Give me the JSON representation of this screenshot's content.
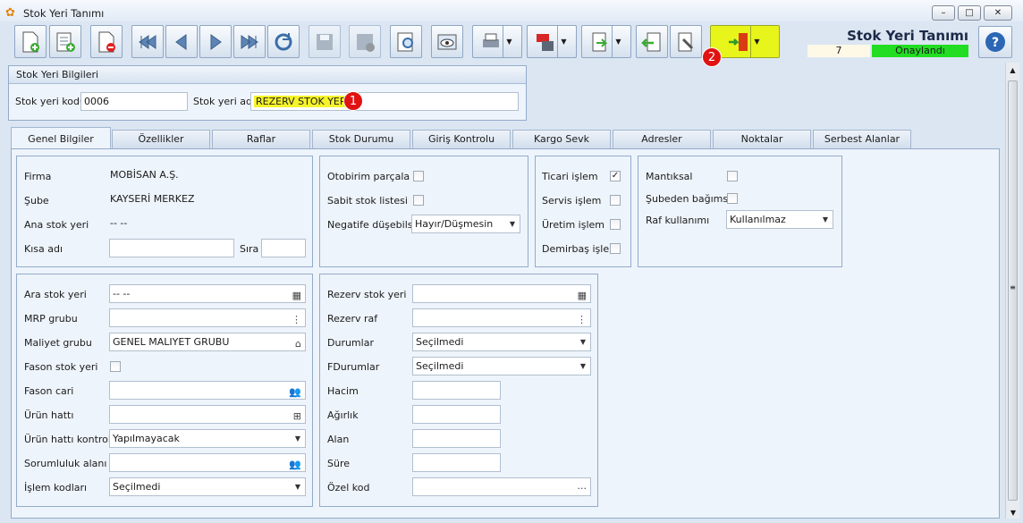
{
  "window": {
    "title": "Stok Yeri Tanımı"
  },
  "header": {
    "title": "Stok Yeri Tanımı",
    "record_no": "7",
    "status": "Onaylandı",
    "status_color": "#22dd22"
  },
  "group": {
    "title": "Stok Yeri Bilgileri",
    "code_label": "Stok yeri kodu",
    "code_value": "0006",
    "name_label": "Stok yeri adı",
    "name_value": "REZERV STOK YERİ"
  },
  "badges": [
    "1",
    "2"
  ],
  "tabs": [
    "Genel Bilgiler",
    "Özellikler",
    "Raflar",
    "Stok Durumu",
    "Giriş Kontrolu",
    "Kargo Sevk",
    "Adresler",
    "Noktalar",
    "Serbest Alanlar"
  ],
  "p1": {
    "firma_label": "Firma",
    "firma_value": "MOBİSAN A.Ş.",
    "sube_label": "Şube",
    "sube_value": "KAYSERİ MERKEZ",
    "ana_label": "Ana stok yeri",
    "ana_value": "-- --",
    "kisa_label": "Kısa adı",
    "sira_label": "Sıra"
  },
  "p2": {
    "oto_label": "Otobirim parçala",
    "sabit_label": "Sabit stok listesi",
    "negatif_label": "Negatife düşebilsin",
    "negatif_value": "Hayır/Düşmesin"
  },
  "p3": {
    "ticari_label": "Ticari işlem",
    "servis_label": "Servis işlem",
    "uretim_label": "Üretim işlem",
    "demirbas_label": "Demirbaş işlem"
  },
  "p4": {
    "mantiksal_label": "Mantıksal",
    "subeden_label": "Şubeden bağımsız",
    "raf_label": "Raf kullanımı",
    "raf_value": "Kullanılmaz"
  },
  "p5": {
    "ara_label": "Ara stok yeri",
    "ara_value": "-- --",
    "mrp_label": "MRP grubu",
    "maliyet_label": "Maliyet grubu",
    "maliyet_value": "GENEL MALIYET GRUBU",
    "fason_label": "Fason stok yeri",
    "fasoncari_label": "Fason cari",
    "urunhatti_label": "Ürün hattı",
    "urunkontrol_label": "Ürün hattı kontrolü",
    "urunkontrol_value": "Yapılmayacak",
    "sorumluluk_label": "Sorumluluk alanı",
    "islem_label": "İşlem kodları",
    "islem_value": "Seçilmedi"
  },
  "p6": {
    "rezerv_label": "Rezerv stok yeri",
    "rezervraf_label": "Rezerv raf",
    "durumlar_label": "Durumlar",
    "durumlar_value": "Seçilmedi",
    "fdurumlar_label": "FDurumlar",
    "fdurumlar_value": "Seçilmedi",
    "hacim_label": "Hacim",
    "agirlik_label": "Ağırlık",
    "alan_label": "Alan",
    "sure_label": "Süre",
    "ozel_label": "Özel kod",
    "ozel_btn": "···"
  }
}
